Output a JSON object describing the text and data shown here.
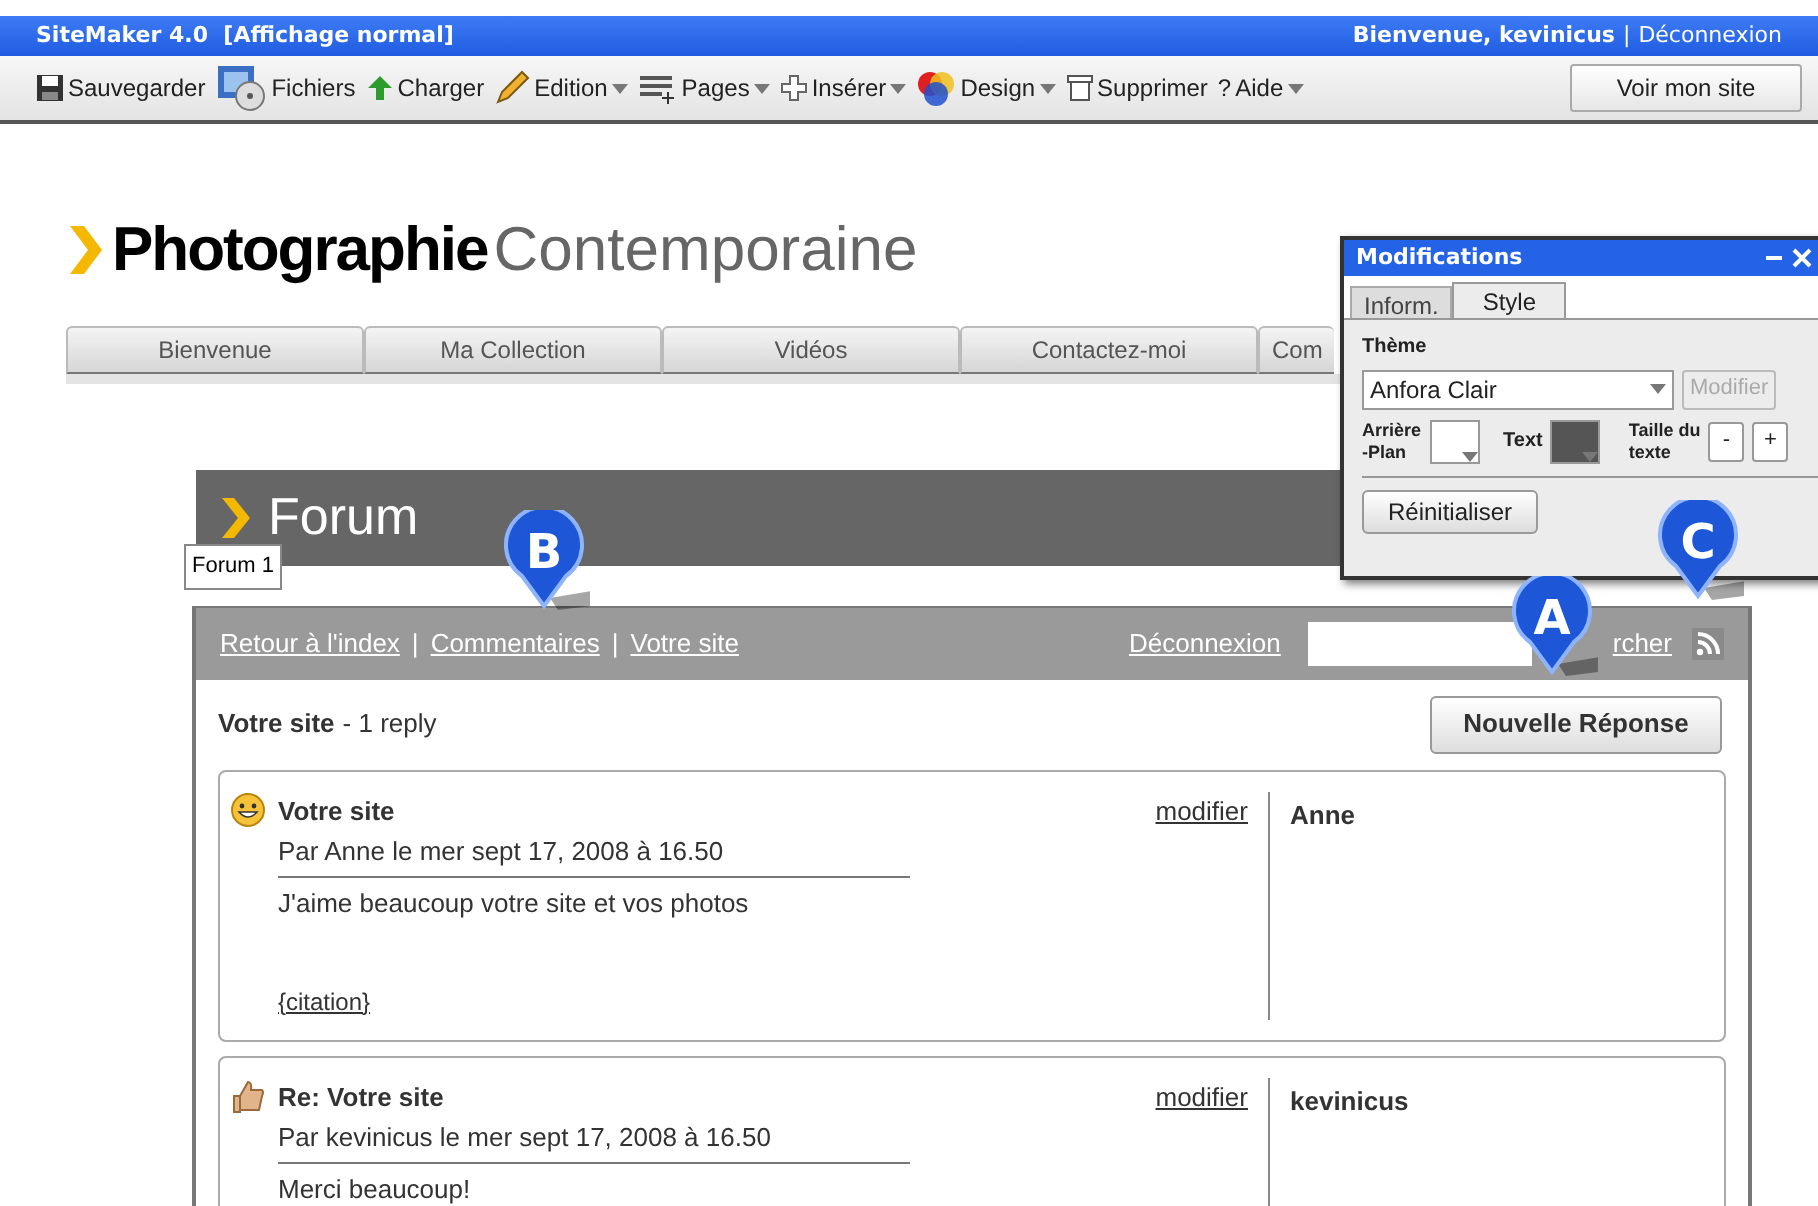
{
  "app_bar": {
    "title": "SiteMaker 4.0  [Affichage normal]",
    "welcome": "Bienvenue, kevinicus",
    "separator": "|",
    "logout": "Déconnexion"
  },
  "toolbar": {
    "items": [
      {
        "kind": "save",
        "label": "Sauvegarder",
        "dropdown": false
      },
      {
        "kind": "files",
        "label": "Fichiers",
        "dropdown": false
      },
      {
        "kind": "upload",
        "label": "Charger",
        "dropdown": false
      },
      {
        "kind": "edit",
        "label": "Edition",
        "dropdown": true
      },
      {
        "kind": "pages",
        "label": "Pages",
        "dropdown": true
      },
      {
        "kind": "insert",
        "label": "Insérer",
        "dropdown": true
      },
      {
        "kind": "design",
        "label": "Design",
        "dropdown": true
      },
      {
        "kind": "delete",
        "label": "Supprimer",
        "dropdown": false
      },
      {
        "kind": "help",
        "label": "Aide",
        "dropdown": true
      }
    ],
    "help_glyph": "?",
    "view_site": "Voir mon site"
  },
  "site": {
    "logo_bold": "Photographie",
    "logo_light": "Contemporaine",
    "nav_tabs": [
      "Bienvenue",
      "Ma Collection",
      "Vidéos",
      "Contactez-moi",
      "Com"
    ]
  },
  "forum": {
    "title": "Forum",
    "label": "Forum 1",
    "nav_links": [
      "Retour à l'index",
      "Commentaires",
      "Votre site"
    ],
    "nav_separator": "|",
    "logout": "Déconnexion",
    "search_button": "rcher",
    "topic": "Votre site",
    "topic_meta": "- 1 reply",
    "new_reply": "Nouvelle Réponse",
    "posts": [
      {
        "kind": "smile",
        "title": "Votre site",
        "byline": "Par Anne le mer sept 17, 2008 à 16.50",
        "body": "J'aime beaucoup votre site et vos photos",
        "quote": "{citation}",
        "edit": "modifier",
        "author": "Anne"
      },
      {
        "kind": "thumb",
        "title": "Re: Votre site",
        "byline": "Par kevinicus le mer sept 17, 2008 à 16.50",
        "body": "Merci beaucoup!",
        "edit": "modifier",
        "author": "kevinicus"
      }
    ]
  },
  "panel": {
    "title": "Modifications",
    "tabs": [
      {
        "label": "Inform.",
        "selected": false
      },
      {
        "label": "Style",
        "selected": true
      }
    ],
    "theme_label": "Thème",
    "theme_value": "Anfora Clair",
    "modify": "Modifier",
    "modify_disabled": true,
    "bg_label": [
      "Arrière",
      "-Plan"
    ],
    "text_label": "Text",
    "size_label": [
      "Taille du",
      "texte"
    ],
    "minus": "-",
    "plus": "+",
    "reset": "Réinitialiser"
  },
  "callouts": [
    "A",
    "B",
    "C"
  ]
}
